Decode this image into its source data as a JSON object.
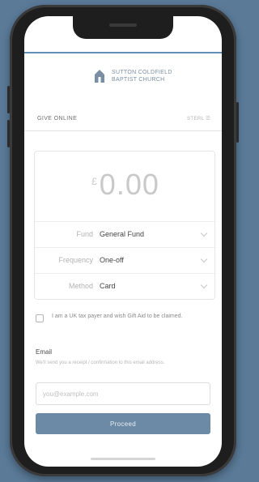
{
  "church": {
    "name_line1": "SUTTON COLDFIELD",
    "name_line2": "BAPTIST CHURCH"
  },
  "header": {
    "title": "GIVE ONLINE",
    "right_link": "STERL ☰"
  },
  "amount": {
    "currency": "£",
    "value": "0.00"
  },
  "fields": [
    {
      "label": "Fund",
      "value": "General Fund"
    },
    {
      "label": "Frequency",
      "value": "One-off"
    },
    {
      "label": "Method",
      "value": "Card"
    }
  ],
  "gift_aid": {
    "checked": false,
    "text": "I am a UK tax payer and wish Gift Aid to be claimed."
  },
  "email": {
    "label": "Email",
    "help": "We'll send you a receipt / confirmation to this email address.",
    "placeholder": "you@example.com",
    "value": ""
  },
  "proceed_label": "Proceed",
  "colors": {
    "background": "#5a7a98",
    "accent": "#6c8aa6",
    "top_line": "#5f8fb5"
  }
}
